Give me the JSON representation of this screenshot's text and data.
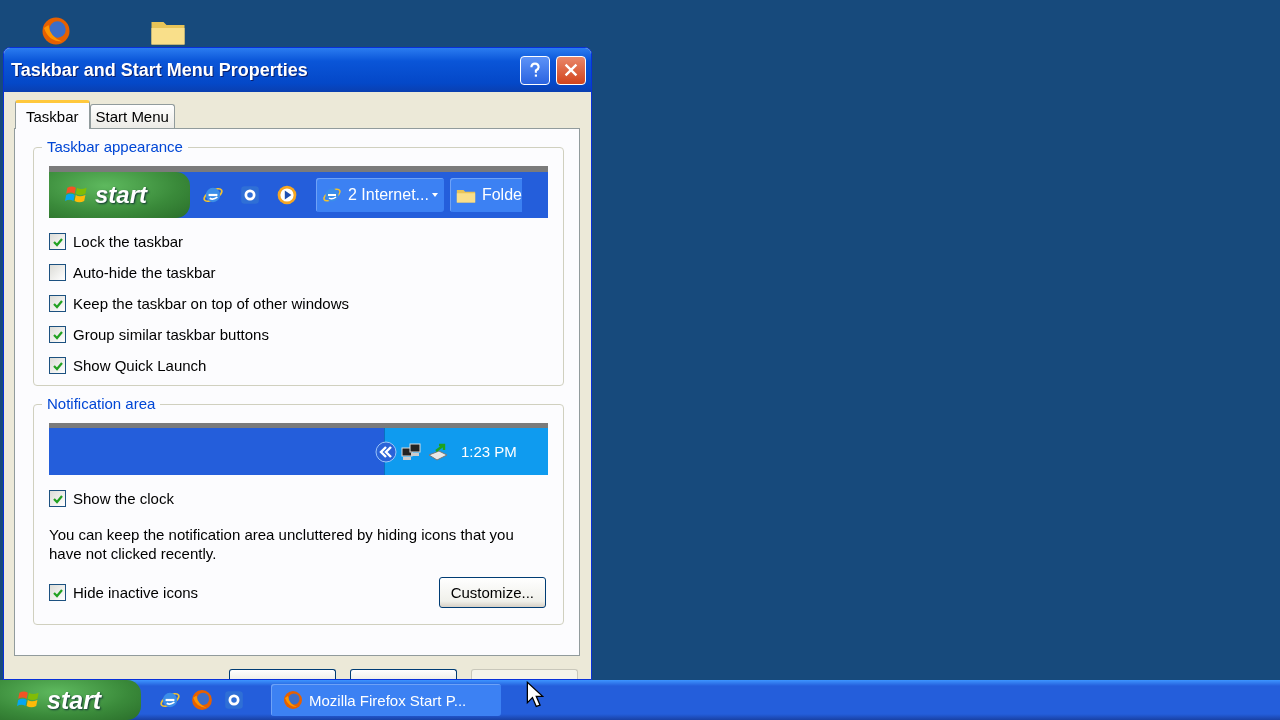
{
  "dialog": {
    "title": "Taskbar and Start Menu Properties",
    "tabs": [
      {
        "label": "Taskbar",
        "selected": true
      },
      {
        "label": "Start Menu",
        "selected": false
      }
    ],
    "appearance": {
      "title": "Taskbar appearance",
      "preview": {
        "start_label": "start",
        "group_button": "2 Internet...",
        "folder_button": "Folde"
      },
      "options": [
        {
          "label": "Lock the taskbar",
          "checked": true
        },
        {
          "label": "Auto-hide the taskbar",
          "checked": false
        },
        {
          "label": "Keep the taskbar on top of other windows",
          "checked": true
        },
        {
          "label": "Group similar taskbar buttons",
          "checked": true
        },
        {
          "label": "Show Quick Launch",
          "checked": true
        }
      ]
    },
    "notification": {
      "title": "Notification area",
      "preview": {
        "clock": "1:23 PM"
      },
      "clock_option": {
        "label": "Show the clock",
        "checked": true
      },
      "note": "You can keep the notification area uncluttered by hiding icons that you have not clicked recently.",
      "hide_option": {
        "label": "Hide inactive icons",
        "checked": true
      },
      "customize_button": "Customize..."
    },
    "footer_buttons": [
      {
        "disabled": false
      },
      {
        "disabled": false
      },
      {
        "disabled": true
      }
    ]
  },
  "taskbar": {
    "start_label": "start",
    "tasks": [
      {
        "label": "Mozilla Firefox Start P..."
      }
    ]
  }
}
